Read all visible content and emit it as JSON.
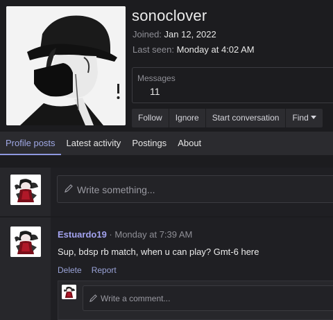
{
  "profile": {
    "username": "sonoclover",
    "joined_label": "Joined:",
    "joined_value": "Jan 12, 2022",
    "last_seen_label": "Last seen:",
    "last_seen_value": "Monday at 4:02 AM",
    "messages_label": "Messages",
    "messages_value": "11"
  },
  "actions": {
    "follow": "Follow",
    "ignore": "Ignore",
    "start_conversation": "Start conversation",
    "find": "Find"
  },
  "tabs": [
    {
      "label": "Profile posts",
      "active": true
    },
    {
      "label": "Latest activity",
      "active": false
    },
    {
      "label": "Postings",
      "active": false
    },
    {
      "label": "About",
      "active": false
    }
  ],
  "composer": {
    "placeholder": "Write something..."
  },
  "post": {
    "author": "Estuardo19",
    "separator": " · ",
    "time": "Monday at 7:39 AM",
    "body": "Sup, bdsp rb match, when u can play? Gmt-6 here",
    "delete_label": "Delete",
    "report_label": "Report"
  },
  "comment": {
    "placeholder": "Write a comment..."
  },
  "colors": {
    "accent": "#a0a9e6",
    "author": "#a3a3f0",
    "background": "#1c1c1f",
    "tab_bar": "#2b2b2f"
  },
  "icons": {
    "composer": "pencil-icon",
    "comment": "pencil-icon",
    "find_menu": "caret-down-icon"
  }
}
